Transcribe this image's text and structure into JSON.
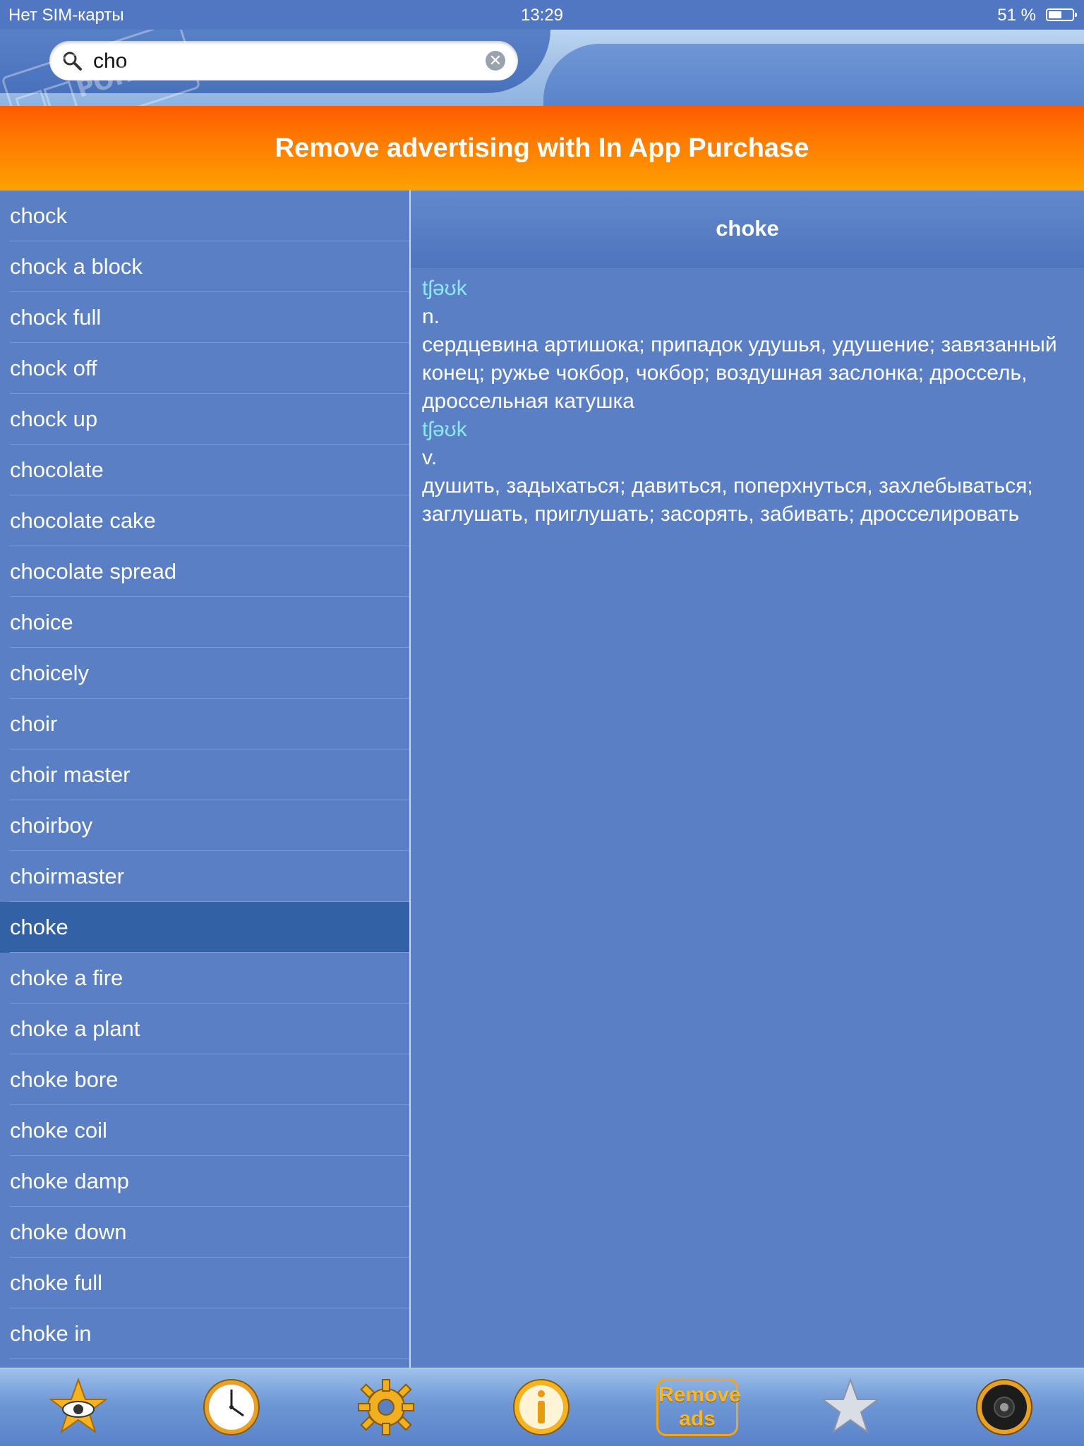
{
  "status_bar": {
    "carrier": "Нет SIM-карты",
    "time": "13:29",
    "battery": "51 %"
  },
  "search": {
    "value": "cho",
    "icons": {
      "search": "magnifier-icon",
      "clear": "clear-x-icon"
    }
  },
  "banner": {
    "text": "Remove advertising with In App Purchase"
  },
  "word_list": {
    "items": [
      "chock",
      "chock a block",
      "chock full",
      "chock off",
      "chock up",
      "chocolate",
      "chocolate cake",
      "chocolate spread",
      "choice",
      "choicely",
      "choir",
      "choir master",
      "choirboy",
      "choirmaster",
      "choke",
      "choke a fire",
      "choke a plant",
      "choke bore",
      "choke coil",
      "choke damp",
      "choke down",
      "choke full",
      "choke in"
    ],
    "selected_index": 14
  },
  "detail": {
    "title": "choke",
    "entries": [
      {
        "transcription": "tʃəʊk",
        "pos": "n.",
        "translation": "сердцевина артишока; припадок удушья, удушение; завязанный конец; ружье чокбор, чокбор; воздушная заслонка; дроссель, дроссельная катушка"
      },
      {
        "transcription": "tʃəʊk",
        "pos": "v.",
        "translation": "душить, задыхаться; давиться, поперхнуться, захлебываться; заглушать, приглушать; засорять, забивать; дросселировать"
      }
    ]
  },
  "toolbar": {
    "remove_ads_line1": "Remove",
    "remove_ads_line2": "ads",
    "icons": [
      "star-eye-icon",
      "clock-icon",
      "gear-icon",
      "info-icon",
      "remove-ads-icon",
      "star-icon",
      "speaker-icon"
    ]
  },
  "colors": {
    "background": "#5a7fc5",
    "selected_row": "#3261a6",
    "banner_orange": "#ff7a00",
    "transcription": "#8ce8f0",
    "icon_gold": "#f5b321"
  }
}
